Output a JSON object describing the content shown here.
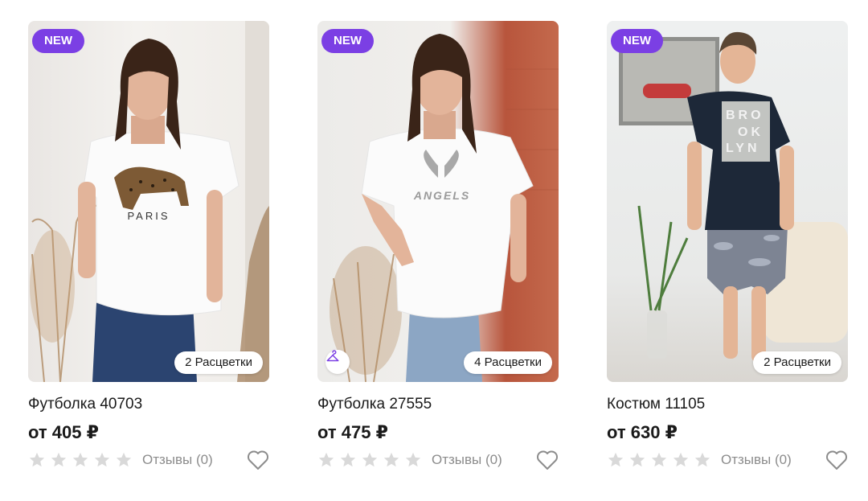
{
  "products": [
    {
      "badge": "NEW",
      "name": "Футболка 40703",
      "price": "от 405 ₽",
      "colors": "2 Расцветки",
      "reviews": "Отзывы (0)",
      "rating": 0,
      "print_text": "PARIS"
    },
    {
      "badge": "NEW",
      "name": "Футболка 27555",
      "price": "от 475 ₽",
      "colors": "4 Расцветки",
      "reviews": "Отзывы (0)",
      "rating": 0,
      "print_text": "ANGELS",
      "extra_icon": "hanger-icon"
    },
    {
      "badge": "NEW",
      "name": "Костюм 11105",
      "price": "от 630 ₽",
      "colors": "2 Расцветки",
      "reviews": "Отзывы (0)",
      "rating": 0,
      "print_text": [
        "BRO",
        "OK",
        "LYN"
      ]
    }
  ],
  "colors": {
    "accent": "#7b3fe4",
    "star_empty": "#d9d9d9",
    "muted_text": "#8c8c8c"
  }
}
